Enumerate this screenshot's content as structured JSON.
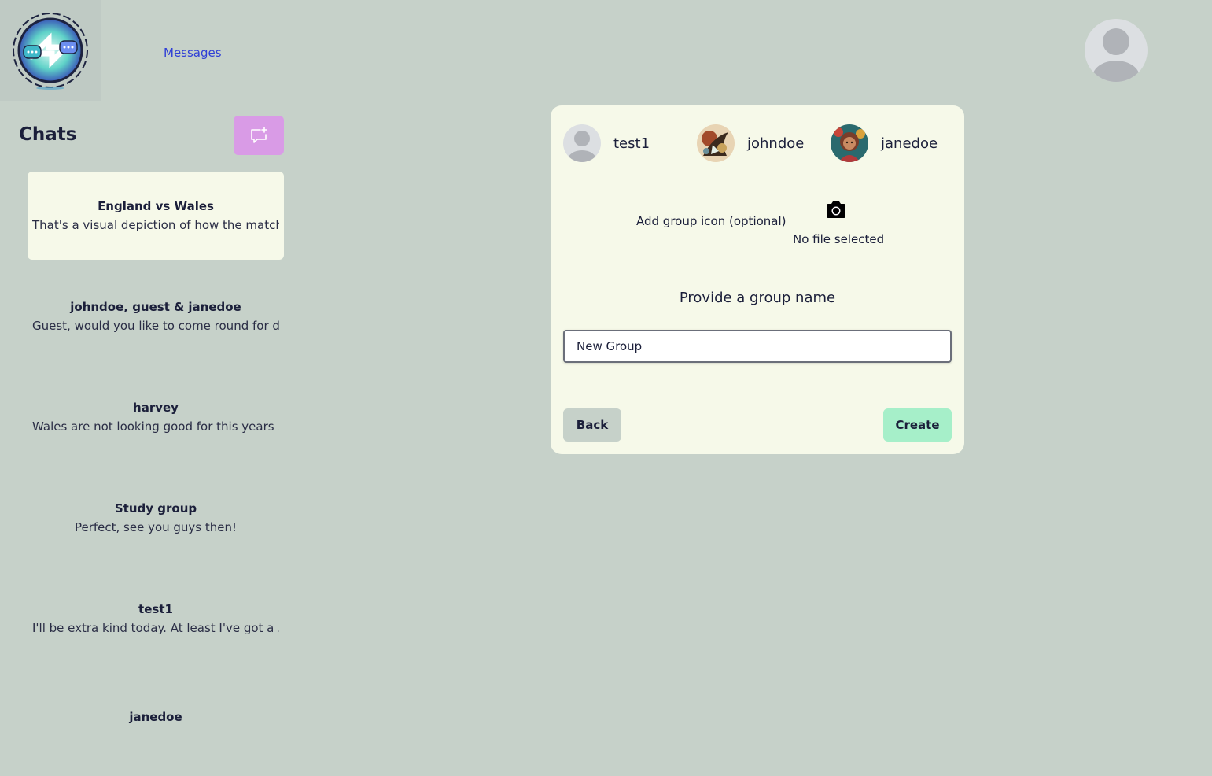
{
  "header": {
    "nav_messages": "Messages"
  },
  "sidebar": {
    "title": "Chats",
    "chats": [
      {
        "name": "England vs Wales",
        "preview": "That's a visual depiction of how the match..."
      },
      {
        "name": "johndoe, guest & janedoe",
        "preview": "Guest, would you like to come round for d..."
      },
      {
        "name": "harvey",
        "preview": "Wales are not looking good for this years ..."
      },
      {
        "name": "Study group",
        "preview": "Perfect, see you guys then!"
      },
      {
        "name": "test1",
        "preview": "I'll be extra kind today. At least I've got a ..."
      },
      {
        "name": "janedoe",
        "preview": ""
      }
    ]
  },
  "create_group": {
    "members": [
      {
        "name": "test1",
        "avatar": "default-avatar"
      },
      {
        "name": "johndoe",
        "avatar": "dragon-art-avatar"
      },
      {
        "name": "janedoe",
        "avatar": "girl-art-avatar"
      }
    ],
    "icon_label": "Add group icon (optional)",
    "file_status": "No file selected",
    "group_prompt": "Provide a group name",
    "group_name_value": "New Group",
    "back_label": "Back",
    "create_label": "Create"
  },
  "colors": {
    "background": "#c6d1c9",
    "card": "#f6f9e9",
    "new_chat_button": "#d99be6",
    "create_button": "#a6efc9",
    "link": "#2f3fd6"
  }
}
